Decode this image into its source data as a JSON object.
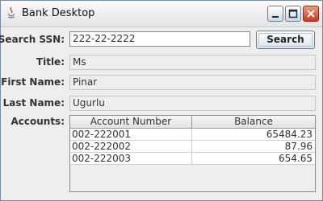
{
  "window": {
    "title": "Bank Desktop",
    "buttons": [
      "minimize-icon",
      "maximize-icon",
      "close-icon"
    ]
  },
  "form": {
    "search_label": "Search SSN:",
    "search_value": "222-22-2222",
    "search_button": "Search",
    "title_label": "Title:",
    "title_value": "Ms",
    "first_name_label": "First Name:",
    "first_name_value": "Pinar",
    "last_name_label": "Last Name:",
    "last_name_value": "Ugurlu",
    "accounts_label": "Accounts:"
  },
  "accounts": {
    "columns": [
      "Account Number",
      "Balance"
    ],
    "rows": [
      {
        "number": "002-222001",
        "balance": "65484.23"
      },
      {
        "number": "002-222002",
        "balance": "87.96"
      },
      {
        "number": "002-222003",
        "balance": "654.65"
      }
    ]
  }
}
